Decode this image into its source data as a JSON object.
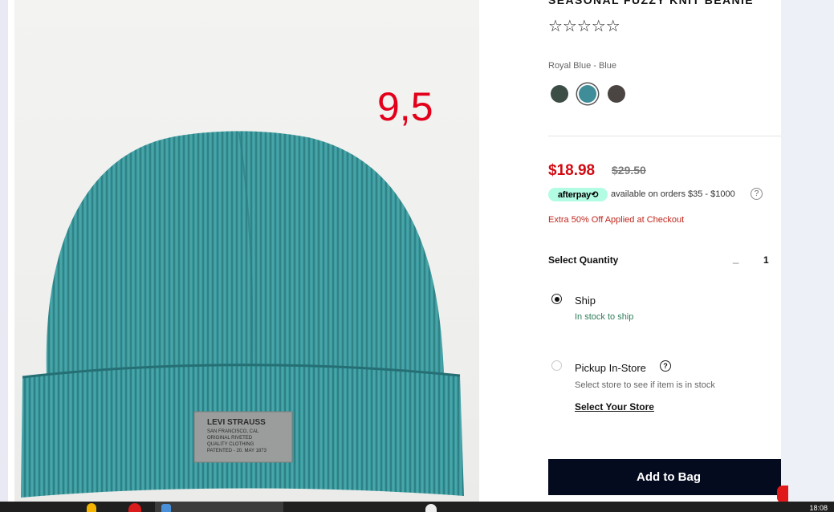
{
  "product": {
    "title": "SEASONAL FUZZY KNIT BEANIE",
    "rating_stars": "☆☆☆☆☆",
    "color_name": "Royal Blue - Blue",
    "swatches": [
      {
        "name": "dark-green",
        "color": "#3c4d45"
      },
      {
        "name": "royal-blue-blue",
        "color": "#3e8d98",
        "selected": true
      },
      {
        "name": "charcoal",
        "color": "#4a4542"
      }
    ],
    "image_label_lines": [
      "LEVI STRAUSS",
      "SAN FRANCISCO, CAL",
      "ORIGINAL RIVETED",
      "QUALITY CLOTHING",
      "PATENTED - 20. MAY 1873"
    ]
  },
  "annotation": "9,5",
  "pricing": {
    "sale": "$18.98",
    "original": "$29.50",
    "afterpay_badge": "afterpay⟲",
    "afterpay_text": "available on orders $35 - $1000",
    "help_glyph": "?",
    "promo": "Extra 50% Off Applied at Checkout"
  },
  "quantity": {
    "label": "Select Quantity",
    "minus": "_",
    "value": "1"
  },
  "fulfillment": {
    "ship_label": "Ship",
    "ship_status": "In stock to ship",
    "pickup_label": "Pickup In-Store",
    "pickup_info_glyph": "?",
    "pickup_status": "Select store to see if item is in stock",
    "select_store": "Select Your Store"
  },
  "cta": {
    "add_to_bag": "Add to Bag"
  },
  "taskbar": {
    "clock": "18:08"
  },
  "colors": {
    "sale_red": "#d20a11",
    "cta_navy": "#040b1f",
    "afterpay_mint": "#b2fce4",
    "stock_green": "#2e7d5b"
  }
}
